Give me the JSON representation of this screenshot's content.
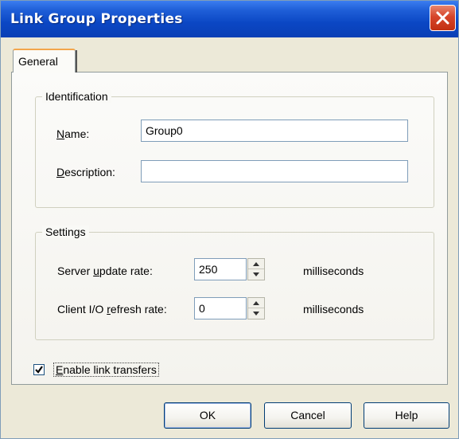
{
  "window": {
    "title": "Link Group Properties"
  },
  "tabs": [
    {
      "label": "General",
      "active": true
    }
  ],
  "identification": {
    "legend": "Identification",
    "name_label_accel": "N",
    "name_label_rest": "ame:",
    "name_value": "Group0",
    "description_label_accel": "D",
    "description_label_rest": "escription:",
    "description_value": ""
  },
  "settings": {
    "legend": "Settings",
    "server_rate_label_pre": "Server ",
    "server_rate_label_accel": "u",
    "server_rate_label_post": "pdate rate:",
    "server_rate_value": "250",
    "server_rate_unit": "milliseconds",
    "client_rate_label_pre": "Client I/O ",
    "client_rate_label_accel": "r",
    "client_rate_label_post": "efresh rate:",
    "client_rate_value": "0",
    "client_rate_unit": "milliseconds"
  },
  "options": {
    "enable_link_transfers_accel": "E",
    "enable_link_transfers_rest": "nable link transfers",
    "enable_link_transfers_checked": true
  },
  "buttons": {
    "ok": "OK",
    "cancel": "Cancel",
    "help": "Help"
  },
  "colors": {
    "titlebar": "#0a47c4",
    "close_button": "#d6452a",
    "dialog_background": "#ece9d8",
    "tab_highlight": "#f3a64c"
  },
  "icons": {
    "close": "close-icon",
    "spin_up": "arrow-up-icon",
    "spin_down": "arrow-down-icon",
    "check": "checkmark-icon"
  }
}
